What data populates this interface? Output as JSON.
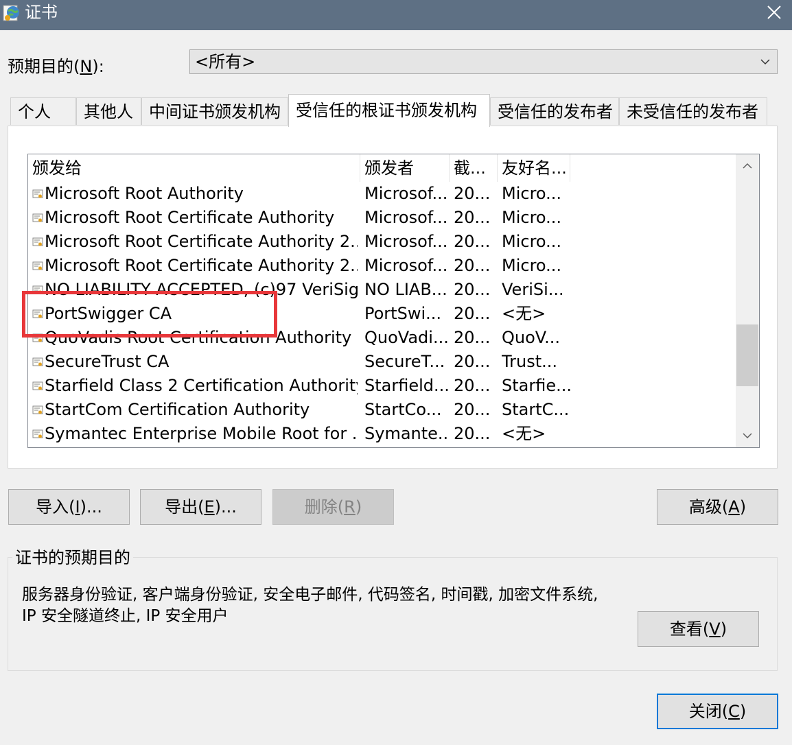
{
  "window": {
    "title": "证书",
    "app_icon": "certificate-globe-icon",
    "close_icon": "close-icon"
  },
  "purpose": {
    "label_prefix": "预期目的(",
    "label_key": "N",
    "label_suffix": "):",
    "selected": "<所有>"
  },
  "tabs": [
    {
      "label": "个人"
    },
    {
      "label": "其他人"
    },
    {
      "label": "中间证书颁发机构"
    },
    {
      "label": "受信任的根证书颁发机构",
      "active": true
    },
    {
      "label": "受信任的发布者"
    },
    {
      "label": "未受信任的发布者"
    }
  ],
  "list": {
    "columns": [
      "颁发给",
      "颁发者",
      "截...",
      "友好名..."
    ],
    "rows": [
      {
        "issued_to": "Microsoft Root Authority",
        "issuer": "Microsof...",
        "expires": "20...",
        "friendly": "Micro..."
      },
      {
        "issued_to": "Microsoft Root Certificate Authority",
        "issuer": "Microsof...",
        "expires": "20...",
        "friendly": "Micro..."
      },
      {
        "issued_to": "Microsoft Root Certificate Authority 2...",
        "issuer": "Microsof...",
        "expires": "20...",
        "friendly": "Micro..."
      },
      {
        "issued_to": "Microsoft Root Certificate Authority 2...",
        "issuer": "Microsof...",
        "expires": "20...",
        "friendly": "Micro..."
      },
      {
        "issued_to": "NO LIABILITY ACCEPTED, (c)97 VeriSig...",
        "issuer": "NO LIAB...",
        "expires": "20...",
        "friendly": "VeriSi..."
      },
      {
        "issued_to": "PortSwigger CA",
        "issuer": "PortSwi...",
        "expires": "20...",
        "friendly": "<无>"
      },
      {
        "issued_to": "QuoVadis Root Certification Authority",
        "issuer": "QuoVadi...",
        "expires": "20...",
        "friendly": "QuoV..."
      },
      {
        "issued_to": "SecureTrust CA",
        "issuer": "SecureT...",
        "expires": "20...",
        "friendly": "Trust..."
      },
      {
        "issued_to": "Starfield Class 2 Certification Authority",
        "issuer": "Starfield...",
        "expires": "20...",
        "friendly": "Starfie..."
      },
      {
        "issued_to": "StartCom Certification Authority",
        "issuer": "StartCo...",
        "expires": "20...",
        "friendly": "StartC..."
      },
      {
        "issued_to": "Symantec Enterprise Mobile Root for ...",
        "issuer": "Symante...",
        "expires": "20...",
        "friendly": "<无>"
      }
    ],
    "highlight_color": "#e8373a"
  },
  "buttons": {
    "import": {
      "text": "导入(",
      "key": "I",
      "suffix": ")..."
    },
    "export": {
      "text": "导出(",
      "key": "E",
      "suffix": ")..."
    },
    "remove": {
      "text": "删除(",
      "key": "R",
      "suffix": ")",
      "disabled": true
    },
    "advanced": {
      "text": "高级(",
      "key": "A",
      "suffix": ")"
    },
    "view": {
      "text": "查看(",
      "key": "V",
      "suffix": ")"
    },
    "close": {
      "text": "关闭(",
      "key": "C",
      "suffix": ")"
    }
  },
  "purposes_group": {
    "title": "证书的预期目的",
    "line1": "服务器身份验证, 客户端身份验证, 安全电子邮件, 代码签名, 时间戳, 加密文件系统,",
    "line2": "IP 安全隧道终止, IP 安全用户"
  }
}
